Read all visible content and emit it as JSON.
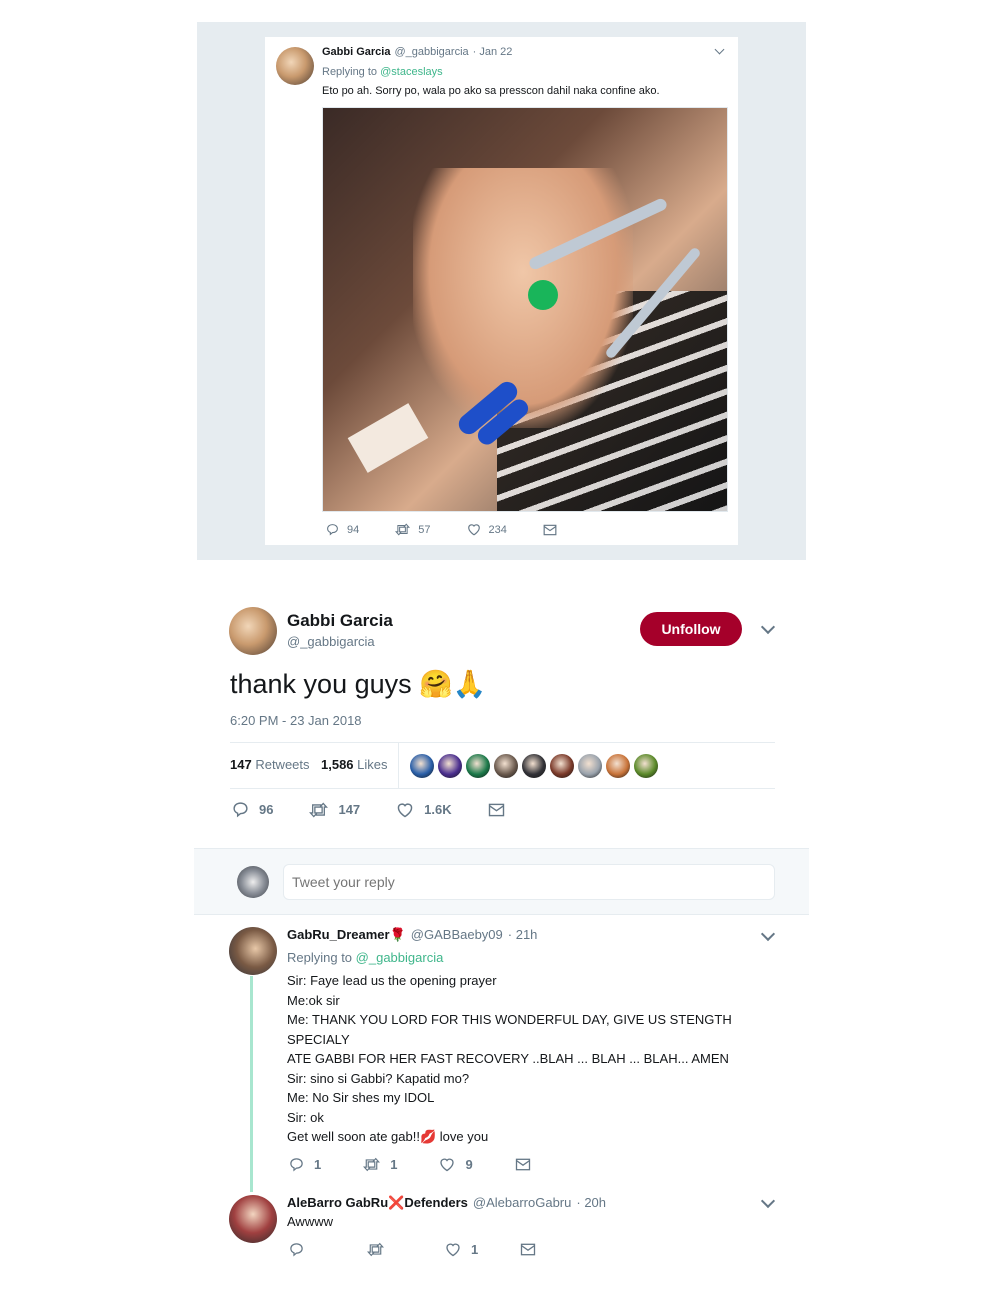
{
  "top_tweet": {
    "name": "Gabbi Garcia",
    "handle": "@_gabbigarcia",
    "date": "· Jan 22",
    "replying_label": "Replying to",
    "replying_to": "@staceslays",
    "text": "Eto po ah. Sorry po, wala po ako sa presscon dahil naka confine ako.",
    "replies": "94",
    "retweets": "57",
    "likes": "234"
  },
  "main_tweet": {
    "name": "Gabbi Garcia",
    "handle": "@_gabbigarcia",
    "follow_button": "Unfollow",
    "text": "thank you guys",
    "emojis": "🤗🙏",
    "timestamp": "6:20 PM - 23 Jan 2018",
    "retweets_count": "147",
    "retweets_label": "Retweets",
    "likes_count": "1,586",
    "likes_label": "Likes",
    "likers": [
      "#2a5fa8",
      "#4b2f8f",
      "#1c7a4a",
      "#6b5a4e",
      "#333338",
      "#7b3a2a",
      "#9aa3ad",
      "#c9743a",
      "#5b8a2a"
    ],
    "replies": "96",
    "retweets": "147",
    "likes": "1.6K"
  },
  "reply_box": {
    "placeholder": "Tweet your reply"
  },
  "replies": [
    {
      "name": "GabRu_Dreamer",
      "name_emoji": "🌹",
      "handle": "@GABBaeby09",
      "time": "· 21h",
      "replying_label": "Replying to",
      "replying_to": "@_gabbigarcia",
      "text": "Sir: Faye lead us the opening prayer\nMe:ok sir\nMe: THANK YOU LORD FOR THIS WONDERFUL DAY, GIVE US STENGTH SPECIALY\nATE GABBI FOR HER FAST RECOVERY ..BLAH ... BLAH ... BLAH... AMEN\nSir: sino si Gabbi? Kapatid mo?\nMe: No Sir shes my IDOL\nSir: ok",
      "text2": "Get well soon ate gab!!💋 love you",
      "replies": "1",
      "retweets": "1",
      "likes": "9"
    },
    {
      "name_a": "AleBarro GabRu",
      "name_x": "❌",
      "name_b": "Defenders",
      "handle": "@AlebarroGabru",
      "time": "· 20h",
      "text": "Awwww",
      "replies": "",
      "retweets": "",
      "likes": "1"
    }
  ],
  "colors": {
    "unfollow_bg": "#a5002a",
    "link_green": "#3fb68b",
    "thread_line": "#a8e6cf",
    "muted": "#657786"
  }
}
